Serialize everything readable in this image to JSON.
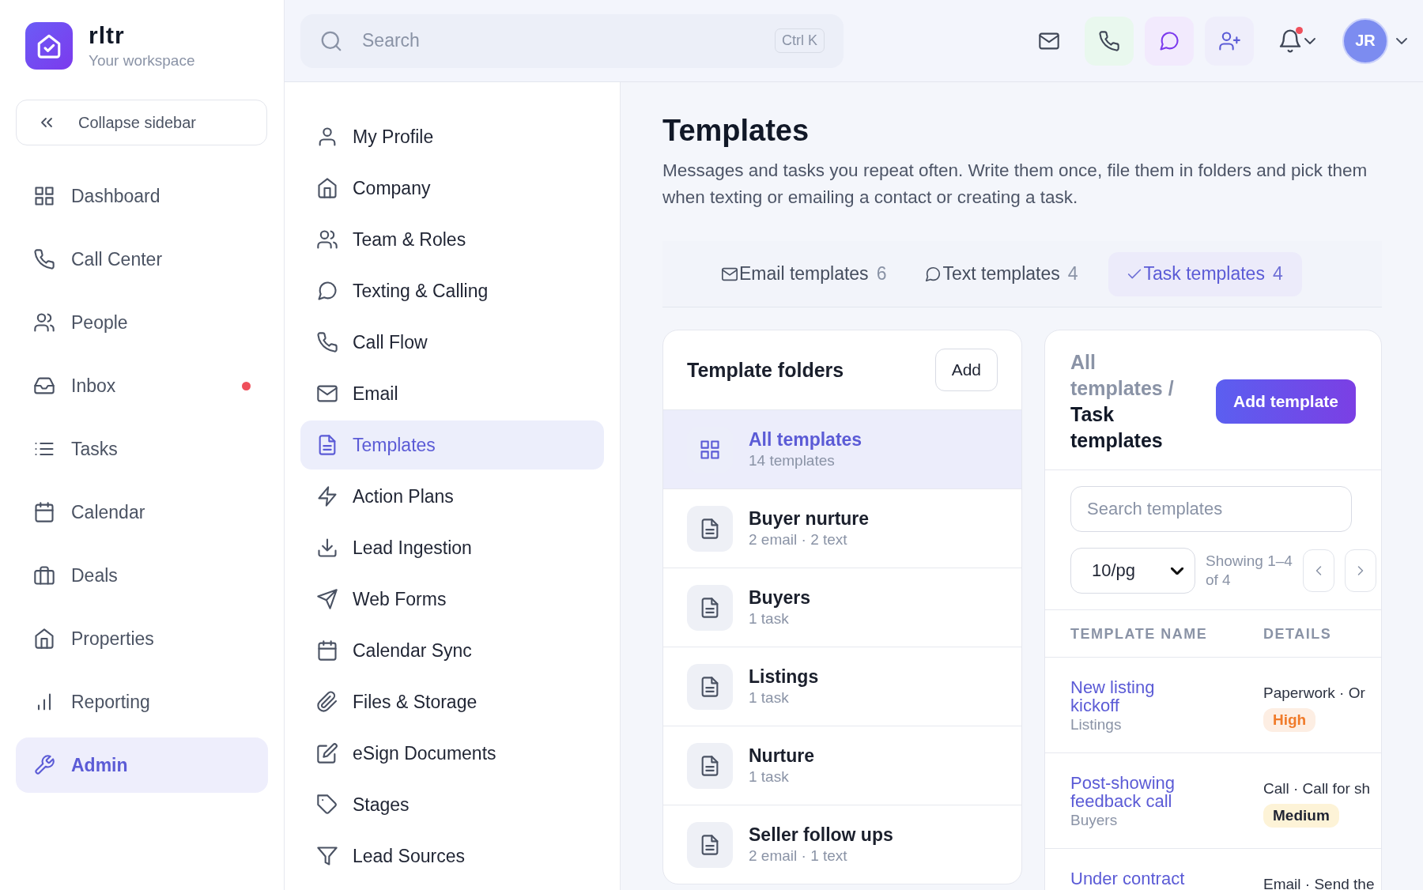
{
  "sidebar": {
    "brand": {
      "name": "rltr",
      "subtitle": "Your workspace"
    },
    "collapse_label": "Collapse sidebar",
    "items": [
      {
        "label": "Dashboard",
        "selected": false,
        "unread": false
      },
      {
        "label": "Call Center",
        "selected": false,
        "unread": false
      },
      {
        "label": "People",
        "selected": false,
        "unread": false
      },
      {
        "label": "Inbox",
        "selected": false,
        "unread": true
      },
      {
        "label": "Tasks",
        "selected": false,
        "unread": false
      },
      {
        "label": "Calendar",
        "selected": false,
        "unread": false
      },
      {
        "label": "Deals",
        "selected": false,
        "unread": false
      },
      {
        "label": "Properties",
        "selected": false,
        "unread": false
      },
      {
        "label": "Reporting",
        "selected": false,
        "unread": false
      },
      {
        "label": "Admin",
        "selected": true,
        "unread": false
      }
    ]
  },
  "topbar": {
    "search": {
      "placeholder": "Search",
      "shortcut": "Ctrl K"
    },
    "notifications_unread": true,
    "avatar": "JR"
  },
  "settings_nav": [
    {
      "label": "My Profile",
      "selected": false
    },
    {
      "label": "Company",
      "selected": false
    },
    {
      "label": "Team & Roles",
      "selected": false
    },
    {
      "label": "Texting & Calling",
      "selected": false
    },
    {
      "label": "Call Flow",
      "selected": false
    },
    {
      "label": "Email",
      "selected": false
    },
    {
      "label": "Templates",
      "selected": true
    },
    {
      "label": "Action Plans",
      "selected": false
    },
    {
      "label": "Lead Ingestion",
      "selected": false
    },
    {
      "label": "Web Forms",
      "selected": false
    },
    {
      "label": "Calendar Sync",
      "selected": false
    },
    {
      "label": "Files & Storage",
      "selected": false
    },
    {
      "label": "eSign Documents",
      "selected": false
    },
    {
      "label": "Stages",
      "selected": false
    },
    {
      "label": "Lead Sources",
      "selected": false
    }
  ],
  "page": {
    "title": "Templates",
    "description": "Messages and tasks you repeat often. Write them once, file them in folders and pick them when texting or emailing a contact or creating a task.",
    "tabs": [
      {
        "label": "Email templates",
        "count": "6",
        "selected": false
      },
      {
        "label": "Text templates",
        "count": "4",
        "selected": false
      },
      {
        "label": "Task templates",
        "count": "4",
        "selected": true
      }
    ],
    "folders": {
      "title": "Template folders",
      "add_label": "Add",
      "items": [
        {
          "name": "All templates",
          "meta": "14 templates",
          "selected": true
        },
        {
          "name": "Buyer nurture",
          "meta": "2 email · 2 text",
          "selected": false
        },
        {
          "name": "Buyers",
          "meta": "1 task",
          "selected": false
        },
        {
          "name": "Listings",
          "meta": "1 task",
          "selected": false
        },
        {
          "name": "Nurture",
          "meta": "1 task",
          "selected": false
        },
        {
          "name": "Seller follow ups",
          "meta": "2 email · 1 text",
          "selected": false
        }
      ]
    },
    "templates": {
      "breadcrumb_parent": "All templates /",
      "breadcrumb_current": "Task templates",
      "add_label": "Add template",
      "search": {
        "placeholder": "Search templates"
      },
      "page_size": "10/pg",
      "showing": "Showing 1–4 of 4",
      "columns": [
        "TEMPLATE NAME",
        "DETAILS"
      ],
      "rows": [
        {
          "name": "New listing kickoff",
          "folder": "Listings",
          "details": "Paperwork · Or",
          "priority": "High",
          "color": "#fdeee3"
        },
        {
          "name": "Post-showing feedback call",
          "folder": "Buyers",
          "details": "Call · Call for sh",
          "priority": "Medium",
          "color": "#fdf3d7"
        },
        {
          "name": "Under contract",
          "details": "Email · Send the"
        }
      ]
    }
  }
}
